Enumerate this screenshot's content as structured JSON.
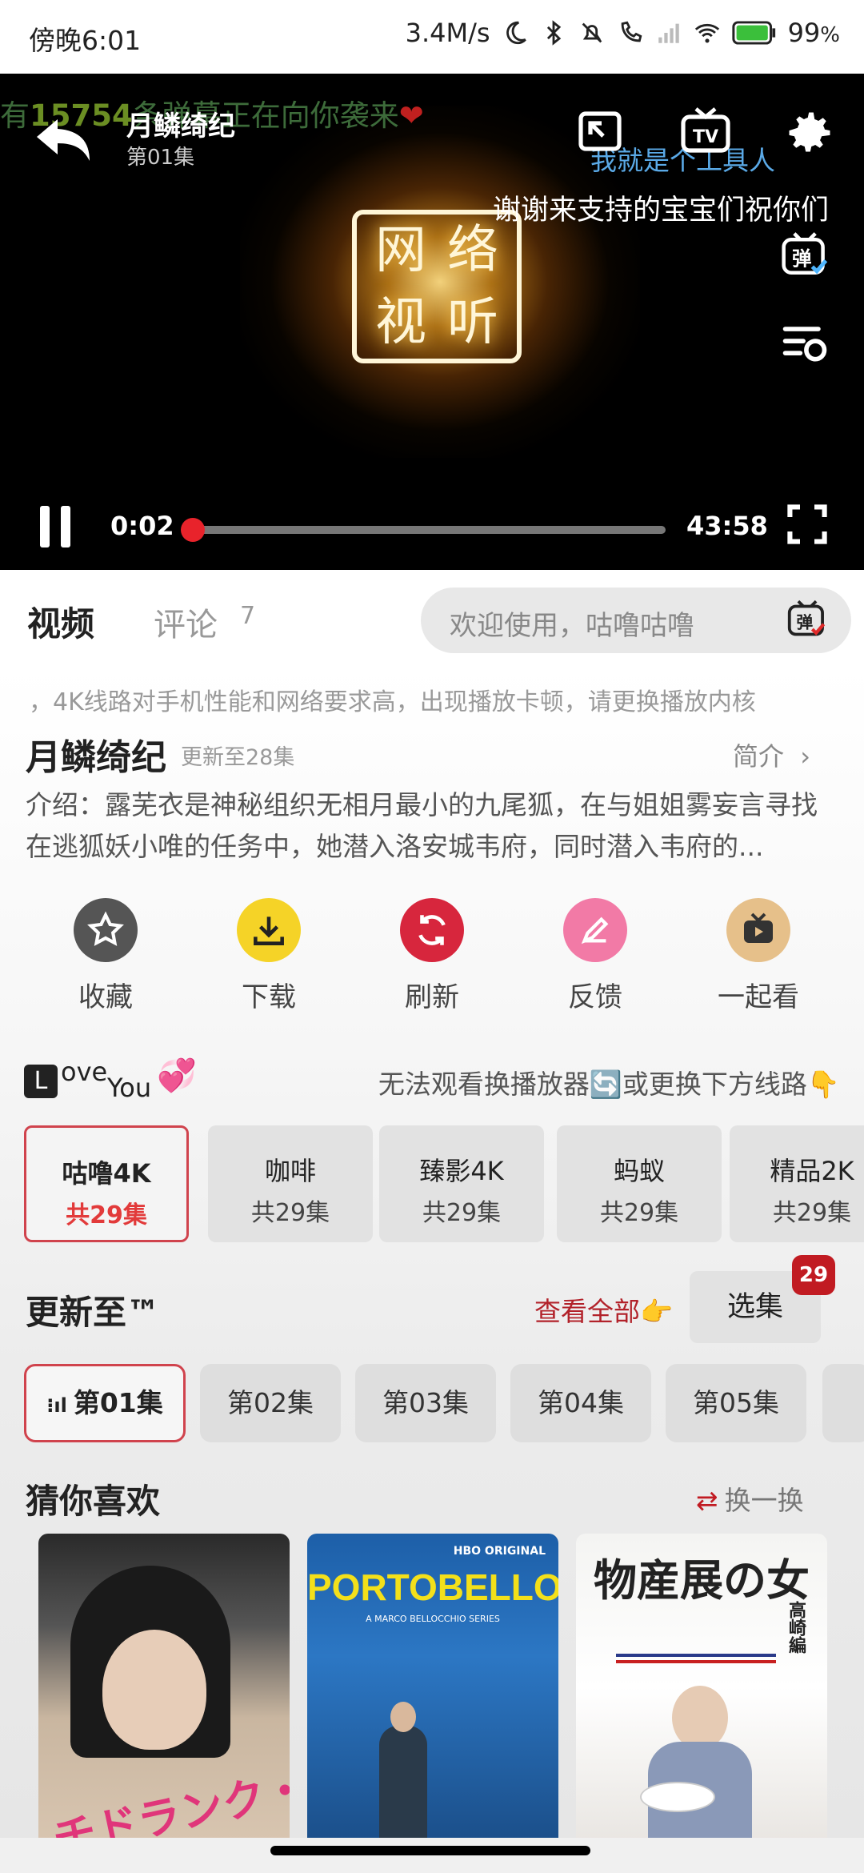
{
  "status": {
    "time": "傍晚6:01",
    "net_speed": "3.4M/s",
    "battery": "99",
    "battery_unit": "%",
    "signal_icons": [
      "moon-icon",
      "bluetooth-icon",
      "mute-icon",
      "call-icon",
      "signal-icon",
      "wifi-icon",
      "battery-icon"
    ]
  },
  "player": {
    "title": "月鳞绮纪",
    "episode": "第01集",
    "danmaku1_a": "有",
    "danmaku1_num": "15754",
    "danmaku1_b": "条弹幕正在向你袭来",
    "danmaku1_heart": "❤",
    "danmaku2": "我就是个工具人",
    "danmaku3": "谢谢来支持的宝宝们祝你们",
    "logo_chars": [
      "网",
      "络",
      "视",
      "听"
    ],
    "current_time": "0:02",
    "duration": "43:58",
    "progress": 0.0008,
    "danmaku_button": "弹"
  },
  "tabs": {
    "video": "视频",
    "comment": "评论",
    "comment_count": "7",
    "danmaku_placeholder": "欢迎使用，咕噜咕噜",
    "danmaku_button": "弹"
  },
  "info": {
    "notice": "，4K线路对手机性能和网络要求高，出现播放卡顿，请更换播放内核",
    "title": "月鳞绮纪",
    "update": "更新至28集",
    "intro_link": "简介",
    "description": "介绍：露芜衣是神秘组织无相月最小的九尾狐，在与姐姐雾妄言寻找在逃狐妖小唯的任务中，她潜入洛安城韦府，同时潜入韦府的..."
  },
  "actions": [
    {
      "label": "收藏",
      "icon": "star-icon",
      "color": "#555555"
    },
    {
      "label": "下载",
      "icon": "download-icon",
      "color": "#f5d327"
    },
    {
      "label": "刷新",
      "icon": "refresh-icon",
      "color": "#d7263d"
    },
    {
      "label": "反馈",
      "icon": "pencil-icon",
      "color": "#f27aa6"
    },
    {
      "label": "一起看",
      "icon": "tv-play-icon",
      "color": "#e6c08a"
    }
  ],
  "lines_section": {
    "badge_letter": "L",
    "badge_text1": "ove",
    "badge_text2": "You",
    "hint": "无法观看换播放器🔄或更换下方线路👇",
    "lines": [
      {
        "name": "咕噜4K",
        "count": "共29集"
      },
      {
        "name": "咖啡",
        "count": "共29集"
      },
      {
        "name": "臻影4K",
        "count": "共29集"
      },
      {
        "name": "蚂蚁",
        "count": "共29集"
      },
      {
        "name": "精品2K",
        "count": "共29集"
      }
    ]
  },
  "episodes_section": {
    "title": "更新至™",
    "see_all": "查看全部👉",
    "select_label": "选集",
    "select_badge": "29",
    "episodes": [
      "第01集",
      "第02集",
      "第03集",
      "第04集",
      "第05集"
    ]
  },
  "guess": {
    "title": "猜你喜欢",
    "swap": "换一换",
    "posters": [
      {
        "title": "チドランク・ウ",
        "accent": "#e0357a"
      },
      {
        "title": "PORTOBELLO",
        "tag": "HBO ORIGINAL",
        "subtitle": "A MARCO BELLOCCHIO SERIES",
        "accent": "#f3e01a"
      },
      {
        "title": "物産展の女",
        "subtitle": "高崎編",
        "accent": "#222222"
      }
    ]
  }
}
